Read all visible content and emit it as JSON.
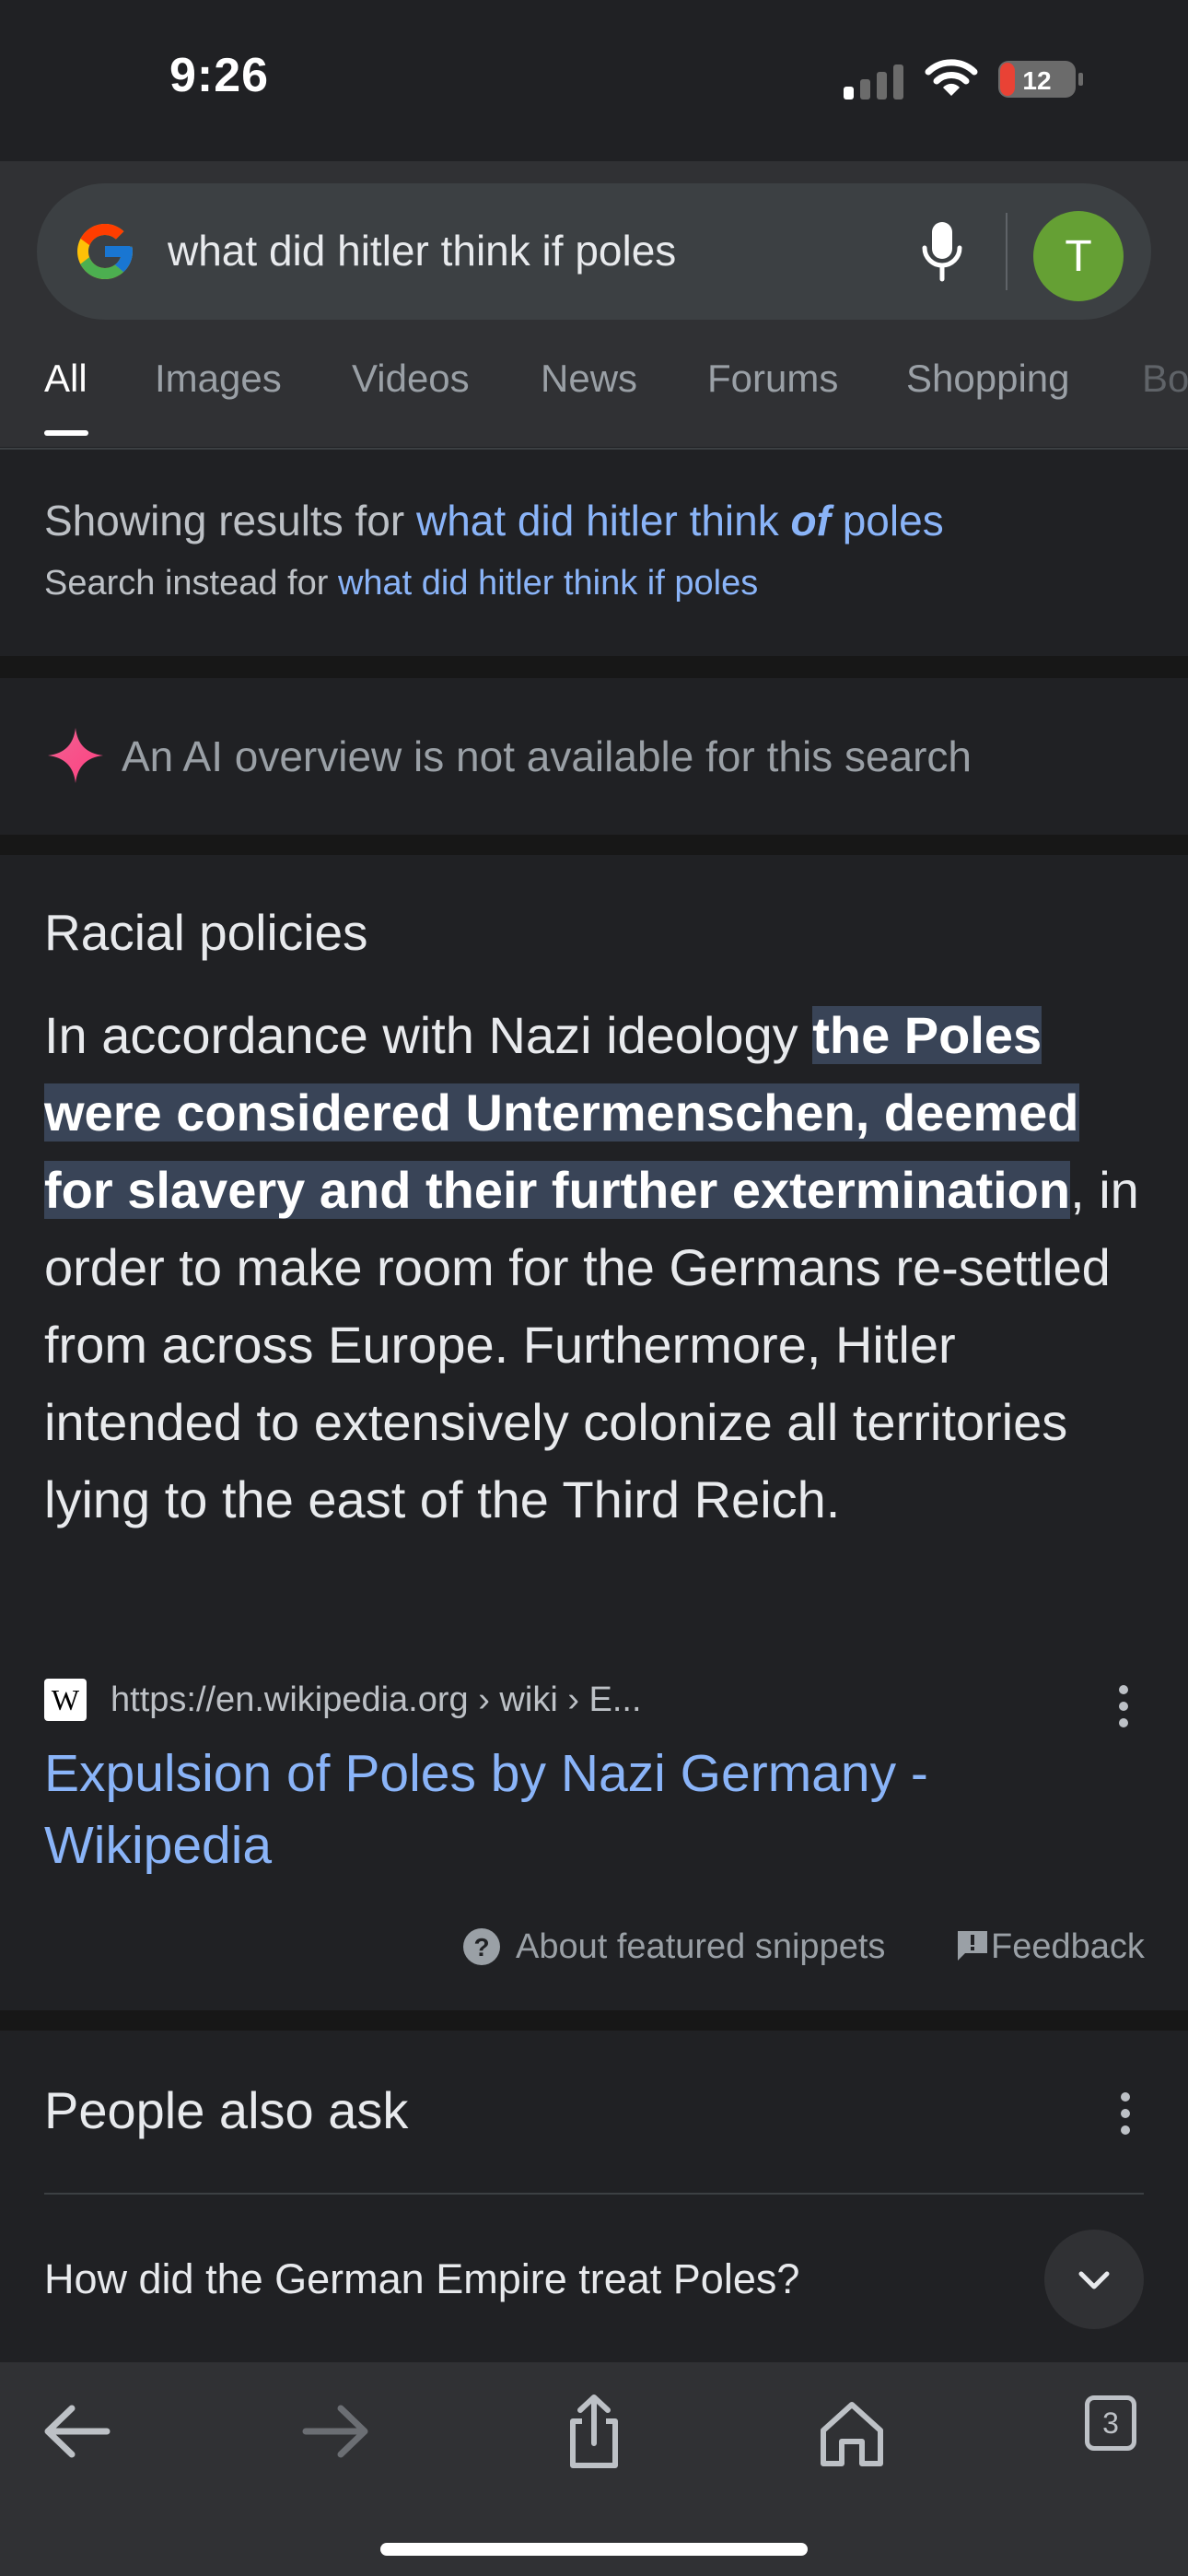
{
  "status_bar": {
    "time": "9:26",
    "battery": "12",
    "battery_color": "#e94235"
  },
  "search": {
    "query": "what did hitler think if poles",
    "avatar_initial": "T",
    "avatar_color": "#65a034",
    "tabs": [
      {
        "label": "All",
        "active": true
      },
      {
        "label": "Images"
      },
      {
        "label": "Videos"
      },
      {
        "label": "News"
      },
      {
        "label": "Forums"
      },
      {
        "label": "Shopping"
      },
      {
        "label": "Bo"
      }
    ]
  },
  "spelling": {
    "showing_prefix": "Showing results for",
    "corrected_before": "what did hitler think",
    "corrected_emph": "of",
    "corrected_after": "poles",
    "instead_prefix": "Search instead for",
    "original_query": "what did hitler think if poles"
  },
  "ai_overview": {
    "text": "An AI overview is not available for this search",
    "icon": "sparkle-icon"
  },
  "featured_snippet": {
    "title": "Racial policies",
    "text_before": "In accordance with Nazi ideology ",
    "text_highlight": "the Poles were considered Untermenschen, deemed for slavery and their further extermination",
    "text_after": ", in order to make room for the Germans re-settled from across Europe. Furthermore, Hitler intended to extensively colonize all territories lying to the east of the Third Reich.",
    "source_favicon": "W",
    "source_url": "https://en.wikipedia.org › wiki › E...",
    "link_title": "Expulsion of Poles by Nazi Germany - Wikipedia",
    "about_label": "About featured snippets",
    "feedback_label": "Feedback"
  },
  "people_also_ask": {
    "title": "People also ask",
    "questions": [
      "How did the German Empire treat Poles?"
    ]
  },
  "toolbar": {
    "tab_count": "3"
  }
}
